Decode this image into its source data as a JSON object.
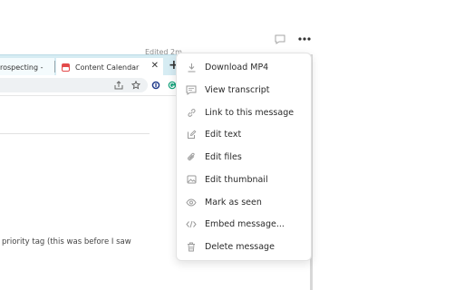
{
  "top_actions": {
    "comment_icon": "comment-icon",
    "more_icon": "more-options-icon"
  },
  "browser": {
    "tabs": [
      {
        "label": "rospecting -"
      },
      {
        "label": "Content Calendar",
        "close": "✕"
      }
    ],
    "new_tab": "+"
  },
  "page": {
    "edited_label": "Edited 2m",
    "body_text": "priority tag (this was before I saw"
  },
  "menu": {
    "items": [
      {
        "label": "Download MP4",
        "icon": "download-icon"
      },
      {
        "label": "View transcript",
        "icon": "transcript-icon"
      },
      {
        "label": "Link to this message",
        "icon": "link-icon"
      },
      {
        "label": "Edit text",
        "icon": "edit-icon"
      },
      {
        "label": "Edit files",
        "icon": "paperclip-icon"
      },
      {
        "label": "Edit thumbnail",
        "icon": "image-icon"
      },
      {
        "label": "Mark as seen",
        "icon": "eye-icon"
      },
      {
        "label": "Embed message...",
        "icon": "code-icon"
      },
      {
        "label": "Delete message",
        "icon": "trash-icon"
      }
    ]
  },
  "colors": {
    "tabstrip": "#d6ecf3",
    "menu_text": "#2b2b2b",
    "icon_gray": "#9a9a9a"
  }
}
